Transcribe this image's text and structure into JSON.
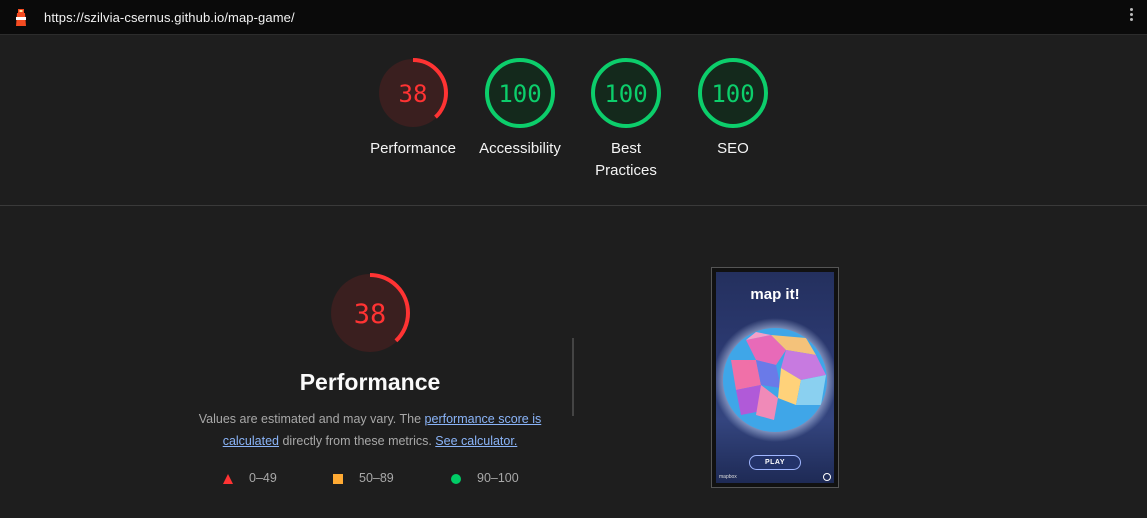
{
  "browser": {
    "url": "https://szilvia-csernus.github.io/map-game/"
  },
  "summary": {
    "gauges": [
      {
        "score": "38",
        "label": "Performance",
        "value": 38,
        "color": "#ff3333"
      },
      {
        "score": "100",
        "label": "Accessibility",
        "value": 100,
        "color": "#0cce6b"
      },
      {
        "score": "100",
        "label_lines": [
          "Best",
          "Practices"
        ],
        "value": 100,
        "color": "#0cce6b"
      },
      {
        "score": "100",
        "label": "SEO",
        "value": 100,
        "color": "#0cce6b"
      }
    ]
  },
  "performance": {
    "score": "38",
    "value": 38,
    "color": "#ff3333",
    "title": "Performance",
    "desc_prefix": "Values are estimated and may vary. The ",
    "desc_link1": "performance score is calculated",
    "desc_middle": " directly from these metrics. ",
    "desc_link2": "See calculator.",
    "legend": [
      {
        "icon": "fail-triangle-icon",
        "range": "0–49",
        "color": "#ff3333"
      },
      {
        "icon": "average-square-icon",
        "range": "50–89",
        "color": "#ffaa33"
      },
      {
        "icon": "pass-circle-icon",
        "range": "90–100",
        "color": "#00cc66"
      }
    ]
  },
  "thumbnail": {
    "title": "map it!",
    "play": "PLAY",
    "attribution": "mapbox"
  }
}
